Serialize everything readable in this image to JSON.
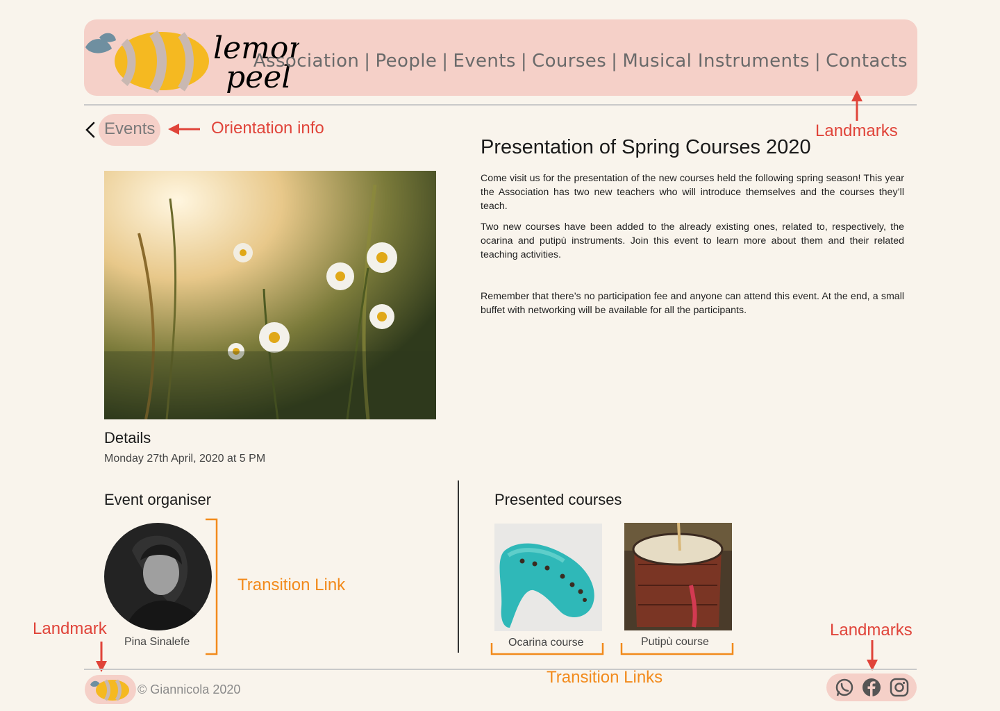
{
  "header": {
    "logo_line1": "lemon",
    "logo_line2": "peel",
    "nav": [
      "Association",
      "People",
      "Events",
      "Courses",
      "Musical Instruments",
      "Contacts"
    ],
    "separator": "|"
  },
  "breadcrumb": {
    "back_label": "Events"
  },
  "annotations": {
    "orientation_info": "Orientation info",
    "landmarks_top": "Landmarks",
    "transition_link": "Transition Link",
    "landmark_footer": "Landmark",
    "landmarks_footer": "Landmarks",
    "transition_links": "Transition Links"
  },
  "event": {
    "title": "Presentation of Spring Courses 2020",
    "paragraphs": [
      "Come visit us for the presentation of the new courses held the following spring season! This year the Association has two new teachers who will introduce themselves and the courses they’ll teach.",
      "Two new courses have been added to the already existing ones, related to, respectively, the ocarina and putipù instruments. Join this event to learn more about them and their related teaching activities.",
      "Remember that there’s no participation fee and anyone can attend this event. At the end, a small buffet with networking will be available for all the participants."
    ],
    "details_heading": "Details",
    "details_date": "Monday 27th April, 2020 at 5 PM"
  },
  "organiser": {
    "heading": "Event organiser",
    "name": "Pina Sinalefe"
  },
  "courses": {
    "heading": "Presented courses",
    "items": [
      {
        "label": "Ocarina course",
        "icon": "ocarina-image"
      },
      {
        "label": "Putipù course",
        "icon": "putipu-drum-image"
      }
    ]
  },
  "footer": {
    "copyright": "© Giannicola 2020",
    "social": [
      "whatsapp-icon",
      "facebook-icon",
      "instagram-icon"
    ]
  },
  "colors": {
    "background": "#f9f4ec",
    "header_pink": "#f5d0c8",
    "annotation_red": "#e0443a",
    "annotation_orange": "#f28a1b",
    "lemon_yellow": "#f5b921",
    "logo_blue_grey": "#6f8fa0"
  }
}
